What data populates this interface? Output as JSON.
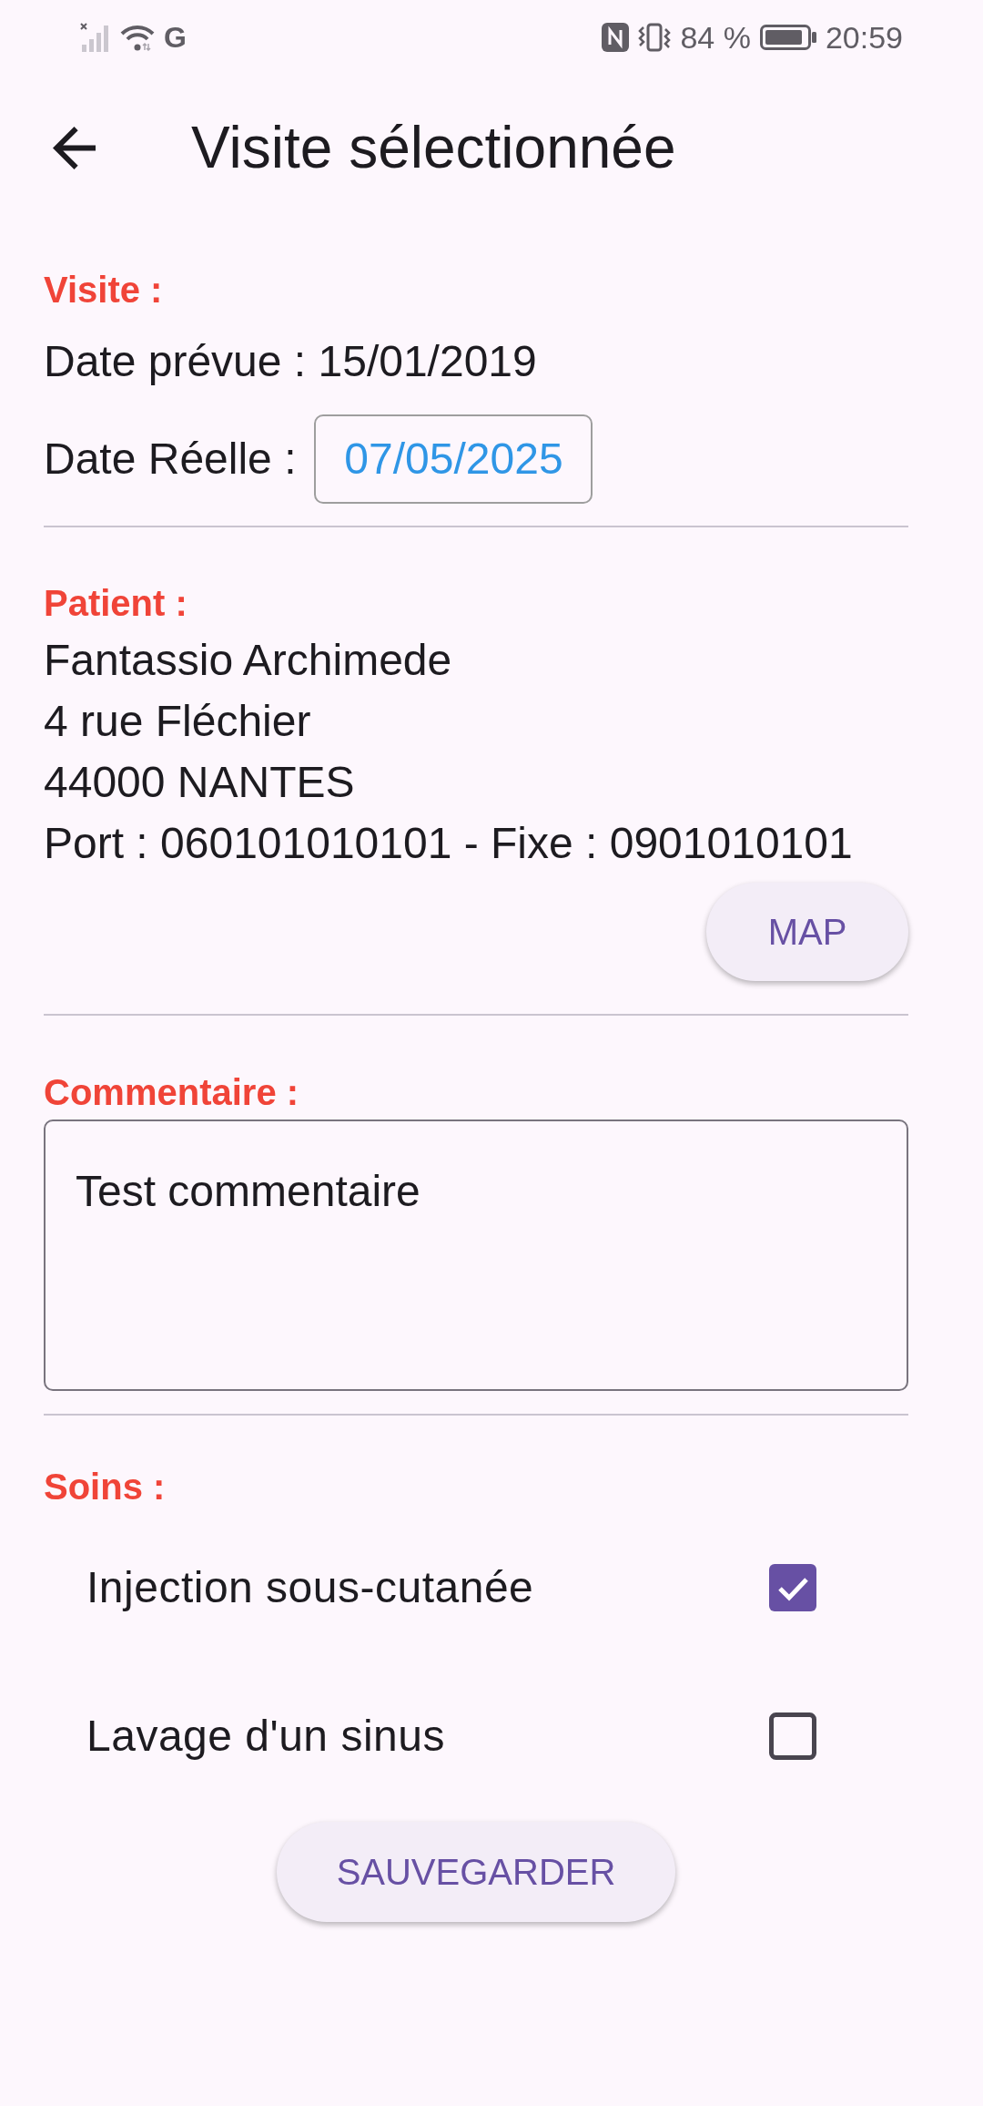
{
  "status_bar": {
    "network_type": "G",
    "battery": "84 %",
    "time": "20:59"
  },
  "app_bar": {
    "title": "Visite sélectionnée"
  },
  "visite": {
    "heading": "Visite :",
    "planned_date": "Date prévue : 15/01/2019",
    "actual_date_label": "Date Réelle :",
    "actual_date": "07/05/2025"
  },
  "patient": {
    "heading": "Patient :",
    "name": "Fantassio Archimede",
    "street": "4 rue Fléchier",
    "city": "44000 NANTES",
    "phones": "Port : 060101010101 - Fixe : 0901010101",
    "map_button": "MAP"
  },
  "comment": {
    "heading": "Commentaire :",
    "value": "Test commentaire"
  },
  "soins": {
    "heading": "Soins :",
    "items": [
      {
        "label": "Injection sous-cutanée",
        "checked": true
      },
      {
        "label": "Lavage d'un sinus",
        "checked": false
      }
    ]
  },
  "save_button": "SAUVEGARDER"
}
